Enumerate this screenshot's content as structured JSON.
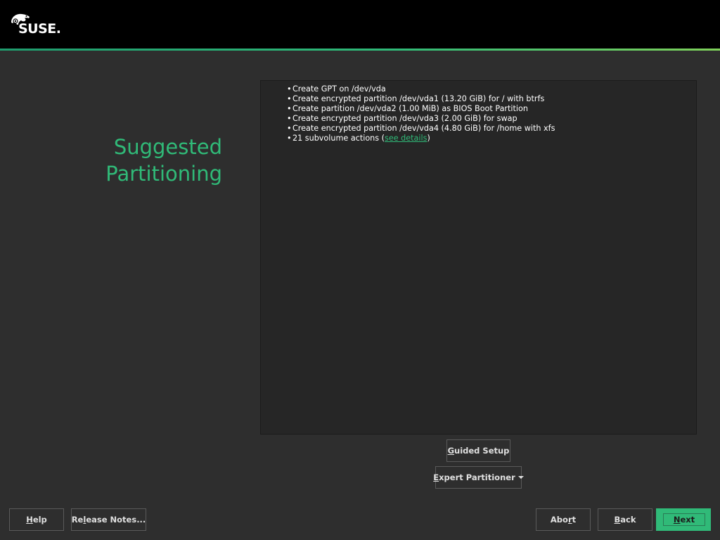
{
  "colors": {
    "accent": "#30ba78",
    "background": "#2e2e2e",
    "header": "#000000",
    "panel": "#262626"
  },
  "header": {
    "logo_text": "SUSE.",
    "logo_icon": "suse-chameleon-icon"
  },
  "page": {
    "title_line1": "Suggested",
    "title_line2": "Partitioning"
  },
  "summary": {
    "items": [
      "Create GPT on /dev/vda",
      "Create encrypted partition /dev/vda1 (13.20 GiB) for / with btrfs",
      "Create partition /dev/vda2 (1.00 MiB) as BIOS Boot Partition",
      "Create encrypted partition /dev/vda3 (2.00 GiB) for swap",
      "Create encrypted partition /dev/vda4 (4.80 GiB) for /home with xfs"
    ],
    "subvolume_prefix": "21 subvolume actions (",
    "subvolume_link": "see details",
    "subvolume_suffix": ")",
    "bullet": "•"
  },
  "buttons": {
    "guided_setup_first": "G",
    "guided_setup_rest": "uided Setup",
    "expert_partitioner_first": "E",
    "expert_partitioner_rest": "xpert Partitioner",
    "help_first": "H",
    "help_rest": "elp",
    "release_notes_pre": "Re",
    "release_notes_ul": "l",
    "release_notes_post": "ease Notes...",
    "abort_pre": "Abo",
    "abort_ul": "r",
    "abort_post": "t",
    "back_first": "B",
    "back_rest": "ack",
    "next_first": "N",
    "next_rest": "ext"
  }
}
